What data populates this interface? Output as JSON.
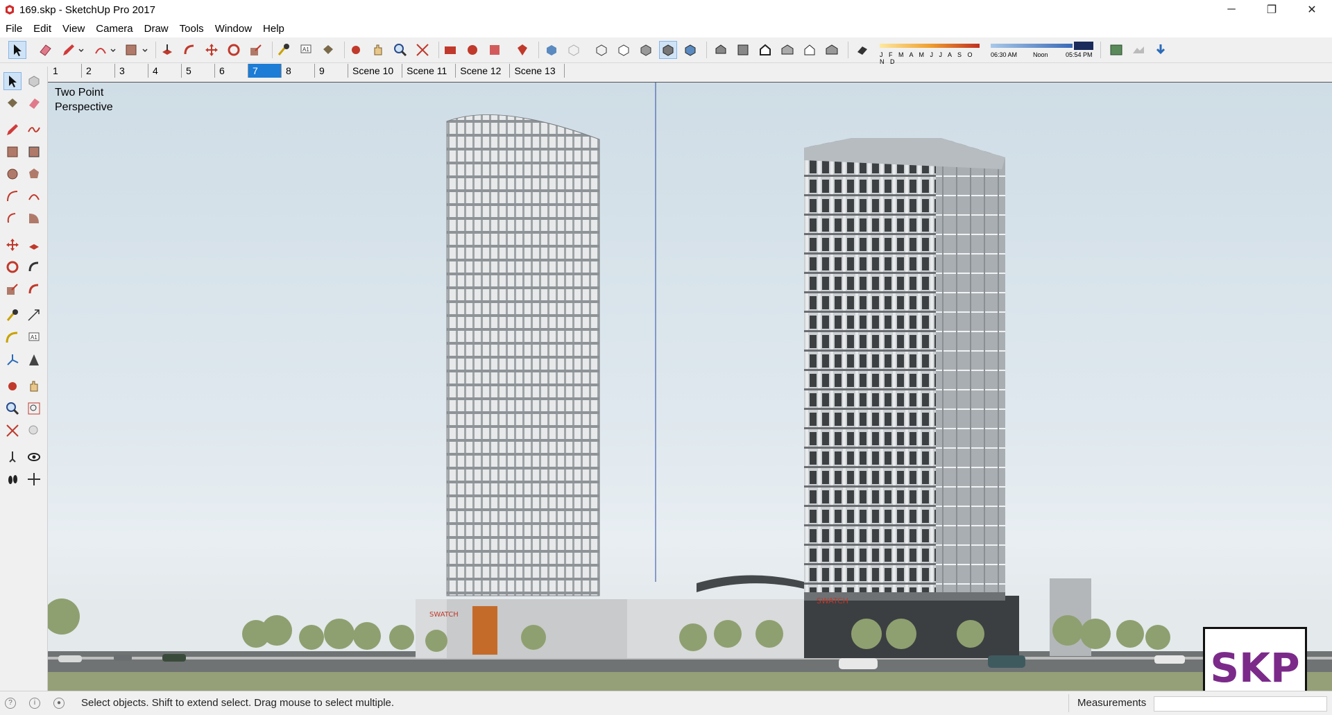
{
  "window": {
    "title": "169.skp - SketchUp Pro 2017",
    "controls": [
      "─",
      "❐",
      "✕"
    ]
  },
  "menu": [
    "File",
    "Edit",
    "View",
    "Camera",
    "Draw",
    "Tools",
    "Window",
    "Help"
  ],
  "toolbar": {
    "shadow_months": "J F M A M J J A S O N D",
    "time_start": "06:30 AM",
    "time_mid": "Noon",
    "time_end": "05:54 PM"
  },
  "scenes": {
    "tabs": [
      "1",
      "2",
      "3",
      "4",
      "5",
      "6",
      "7",
      "8",
      "9",
      "Scene 10",
      "Scene 11",
      "Scene 12",
      "Scene 13"
    ],
    "active": "7"
  },
  "viewport": {
    "camera_line1": "Two Point",
    "camera_line2": "Perspective",
    "sign_left": "SWATCH",
    "sign_right": "SWATCH",
    "logo": "SKP"
  },
  "status": {
    "hint": "Select objects. Shift to extend select. Drag mouse to select multiple.",
    "measurements_label": "Measurements",
    "measurements_value": ""
  },
  "colors": {
    "accent": "#1c7cd6",
    "logo": "#7b2a8a"
  }
}
